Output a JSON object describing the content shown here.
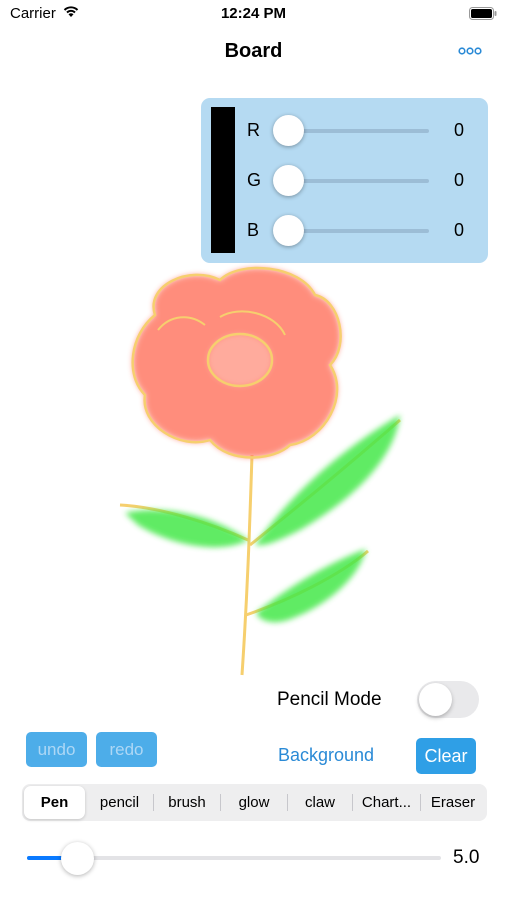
{
  "status_bar": {
    "carrier": "Carrier",
    "time": "12:24 PM"
  },
  "nav": {
    "title": "Board",
    "more_icon": "ellipsis-icon"
  },
  "color_picker": {
    "swatch_color": "#000000",
    "channels": [
      {
        "label": "R",
        "value": "0"
      },
      {
        "label": "G",
        "value": "0"
      },
      {
        "label": "B",
        "value": "0"
      }
    ]
  },
  "pencil_mode": {
    "label": "Pencil Mode",
    "enabled": false
  },
  "actions": {
    "undo": "undo",
    "redo": "redo",
    "background": "Background",
    "clear": "Clear"
  },
  "tools": {
    "items": [
      "Pen",
      "pencil",
      "brush",
      "glow",
      "claw",
      "Chart...",
      "Eraser"
    ],
    "selected": "Pen"
  },
  "brush_size": {
    "value": "5.0",
    "fraction": 0.12
  },
  "colors": {
    "accent": "#0a7aff",
    "button": "#2f9fe6",
    "panel": "#b5daf2",
    "petal": "#ff7a66",
    "leaf": "#44e84a",
    "stem": "#f6cf6e"
  }
}
